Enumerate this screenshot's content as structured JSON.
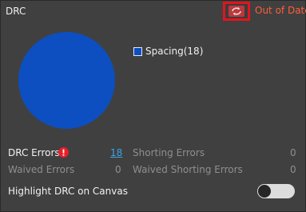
{
  "panel": {
    "title": "DRC",
    "status": "Out of Date"
  },
  "chart_data": {
    "type": "pie",
    "slices": [
      {
        "label": "Spacing(18)",
        "value": 18,
        "color": "#0d4fc0"
      }
    ]
  },
  "legend": {
    "items": [
      {
        "label": "Spacing(18)",
        "color": "#0d4fc0"
      }
    ]
  },
  "summary": {
    "drc_errors_label": "DRC Errors",
    "drc_errors_value": "18",
    "waived_errors_label": "Waived Errors",
    "waived_errors_value": "0",
    "shorting_errors_label": "Shorting Errors",
    "shorting_errors_value": "0",
    "waived_shorting_label": "Waived Shorting Errors",
    "waived_shorting_value": "0"
  },
  "highlight": {
    "label": "Highlight DRC on Canvas",
    "enabled": false
  },
  "colors": {
    "background": "#404040",
    "status": "#ff5e3a",
    "refresh_border": "#e3141c",
    "pie_fill": "#0d4fc0",
    "link": "#3ba3e8",
    "error_icon": "#e81f2a"
  },
  "icons": {
    "refresh": "refresh-icon",
    "error": "error-icon"
  }
}
